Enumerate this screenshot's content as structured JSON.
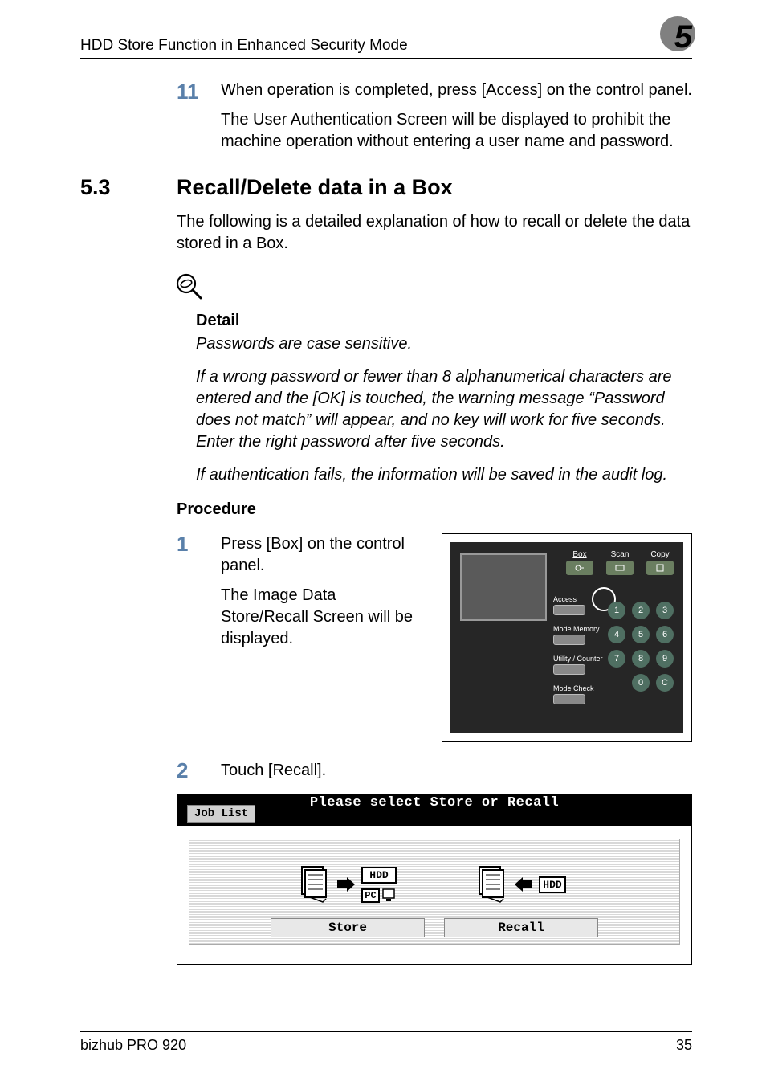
{
  "header": {
    "title": "HDD Store Function in Enhanced Security Mode",
    "chapter": "5"
  },
  "step11": {
    "num": "11",
    "line1": "When operation is completed, press [Access] on the control panel.",
    "line2": "The User Authentication Screen will be displayed to prohibit the machine operation without entering a user name and password."
  },
  "section": {
    "num": "5.3",
    "title": "Recall/Delete data in a Box"
  },
  "intro": "The following is a detailed explanation of how to recall or delete the data stored in a Box.",
  "detail": {
    "heading": "Detail",
    "p1": "Passwords are case sensitive.",
    "p2": "If a wrong password or fewer than 8 alphanumerical characters are entered and the [OK] is touched, the warning message “Password does not match” will appear, and no key will work for five seconds. Enter the right password after five seconds.",
    "p3": "If authentication fails, the information will be saved in the audit log."
  },
  "procedure": {
    "heading": "Procedure",
    "step1": {
      "num": "1",
      "text": "Press [Box] on the control panel.",
      "sub": "The Image Data Store/Recall Screen will be displayed."
    },
    "step2": {
      "num": "2",
      "text": "Touch [Recall]."
    }
  },
  "panel": {
    "tabs": {
      "box": "Box",
      "scan": "Scan",
      "copy": "Copy"
    },
    "labels": {
      "access": "Access",
      "mode_memory": "Mode Memory",
      "utility": "Utility / Counter",
      "mode_check": "Mode Check"
    },
    "keys": [
      "1",
      "2",
      "3",
      "4",
      "5",
      "6",
      "7",
      "8",
      "9",
      "0",
      "C"
    ]
  },
  "touchscreen": {
    "job_list": "Job List",
    "title": "Please select Store or Recall",
    "store": "Store",
    "recall": "Recall",
    "hdd": "HDD",
    "pc": "PC"
  },
  "footer": {
    "model": "bizhub PRO 920",
    "page": "35"
  }
}
